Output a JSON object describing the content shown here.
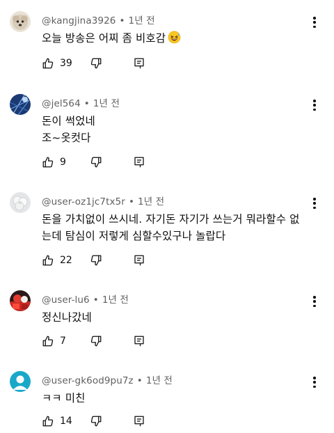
{
  "comments": [
    {
      "username": "@kangjina3926",
      "time": "1년 전",
      "lines": [
        "오늘 방송은 어찌 좀 비호감"
      ],
      "emoji_icon": "laughing-sweat-emoji",
      "likes": "39",
      "avatar_icon": "dog-avatar"
    },
    {
      "username": "@jel564",
      "time": "1년 전",
      "lines": [
        "돈이 썩었네",
        "조~옷컷다"
      ],
      "likes": "9",
      "avatar_icon": "blue-grid-avatar"
    },
    {
      "username": "@user-oz1jc7tx5r",
      "time": "1년 전",
      "lines": [
        "돈을 가치없이 쓰시네. 자기돈 자기가 쓰는거 뭐라할수 없",
        "는데 탐심이 저렇게 심할수있구나 놀랍다"
      ],
      "likes": "22",
      "avatar_icon": "white-flower-avatar"
    },
    {
      "username": "@user-lu6",
      "time": "1년 전",
      "lines": [
        "정신나갔네"
      ],
      "likes": "7",
      "avatar_icon": "red-figure-avatar"
    },
    {
      "username": "@user-gk6od9pu7z",
      "time": "1년 전",
      "lines": [
        "ㅋㅋ 미친"
      ],
      "likes": "14",
      "avatar_icon": "default-person-avatar"
    }
  ],
  "colors": {
    "meta_text": "#606060",
    "body_text": "#0f0f0f",
    "default_avatar": "#1aa8c9"
  }
}
